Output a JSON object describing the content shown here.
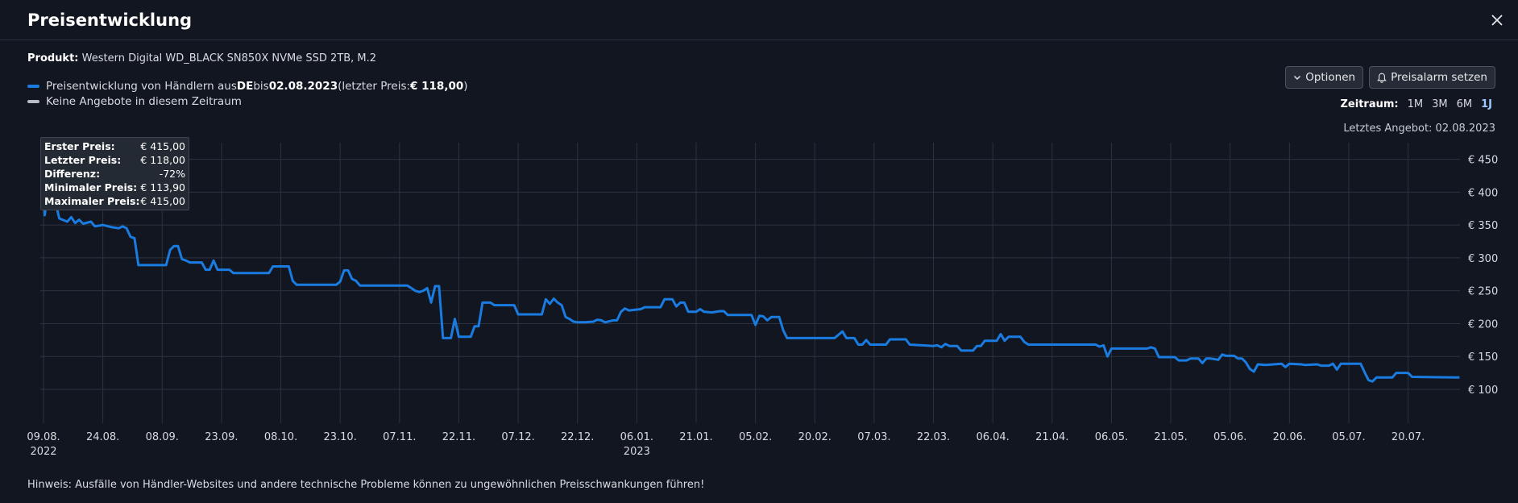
{
  "title": "Preisentwicklung",
  "product": {
    "label": "Produkt:",
    "name": "Western Digital WD_BLACK SN850X NVMe SSD 2TB, M.2"
  },
  "legend": {
    "series_prefix": "Preisentwicklung von Händlern aus ",
    "country": "DE",
    "mid": " bis ",
    "date": "02.08.2023",
    "last_price_prefix": " (letzter Preis: ",
    "last_price": "€ 118,00",
    "suffix": ")",
    "no_offers": "Keine Angebote in diesem Zeitraum",
    "series_color": "#1a7be0",
    "no_offers_color": "#b8bcc4"
  },
  "buttons": {
    "options": "Optionen",
    "alarm": "Preisalarm setzen"
  },
  "zeitraum": {
    "label": "Zeitraum:",
    "options": [
      "1M",
      "3M",
      "6M",
      "1J"
    ],
    "active": "1J"
  },
  "last_offer": "Letztes Angebot: 02.08.2023",
  "stats": [
    {
      "k": "Erster Preis:",
      "v": "€ 415,00"
    },
    {
      "k": "Letzter Preis:",
      "v": "€ 118,00"
    },
    {
      "k": "Differenz:",
      "v": "-72%"
    },
    {
      "k": "Minimaler Preis:",
      "v": "€ 113,90"
    },
    {
      "k": "Maximaler Preis:",
      "v": "€ 415,00"
    }
  ],
  "hint": "Hinweis: Ausfälle von Händler-Websites und andere technische Probleme können zu ungewöhnlichen Preisschwankungen führen!",
  "chart_data": {
    "type": "line",
    "title": "",
    "ylim": [
      50,
      460
    ],
    "y_ticks": [
      100,
      150,
      200,
      250,
      300,
      350,
      400,
      450
    ],
    "y_tick_labels": [
      "€ 100",
      "€ 150",
      "€ 200",
      "€ 250",
      "€ 300",
      "€ 350",
      "€ 400",
      "€ 450"
    ],
    "x_ticks": [
      {
        "x": 0,
        "label": "09.08.",
        "year": "2022"
      },
      {
        "x": 15,
        "label": "24.08."
      },
      {
        "x": 30,
        "label": "08.09."
      },
      {
        "x": 45,
        "label": "23.09."
      },
      {
        "x": 60,
        "label": "08.10."
      },
      {
        "x": 75,
        "label": "23.10."
      },
      {
        "x": 90,
        "label": "07.11."
      },
      {
        "x": 105,
        "label": "22.11."
      },
      {
        "x": 120,
        "label": "07.12."
      },
      {
        "x": 135,
        "label": "22.12."
      },
      {
        "x": 150,
        "label": "06.01.",
        "year": "2023"
      },
      {
        "x": 165,
        "label": "21.01."
      },
      {
        "x": 180,
        "label": "05.02."
      },
      {
        "x": 195,
        "label": "20.02."
      },
      {
        "x": 210,
        "label": "07.03."
      },
      {
        "x": 225,
        "label": "22.03."
      },
      {
        "x": 240,
        "label": "06.04."
      },
      {
        "x": 255,
        "label": "21.04."
      },
      {
        "x": 270,
        "label": "06.05."
      },
      {
        "x": 285,
        "label": "21.05."
      },
      {
        "x": 300,
        "label": "05.06."
      },
      {
        "x": 315,
        "label": "20.06."
      },
      {
        "x": 330,
        "label": "05.07."
      },
      {
        "x": 345,
        "label": "20.07."
      }
    ],
    "x_range": [
      0,
      358
    ],
    "grid": true,
    "series": [
      {
        "color": "#1a7be0",
        "points": [
          [
            0,
            415
          ],
          [
            0.3,
            365
          ],
          [
            1,
            400
          ],
          [
            3,
            385
          ],
          [
            4,
            360
          ],
          [
            6,
            355
          ],
          [
            7,
            362
          ],
          [
            8,
            353
          ],
          [
            9,
            358
          ],
          [
            10,
            352
          ],
          [
            12,
            355
          ],
          [
            13,
            348
          ],
          [
            15,
            350
          ],
          [
            17,
            347
          ],
          [
            19,
            345
          ],
          [
            20,
            348
          ],
          [
            21,
            345
          ],
          [
            22,
            332
          ],
          [
            23,
            330
          ],
          [
            24,
            289
          ],
          [
            30,
            289
          ],
          [
            31,
            289
          ],
          [
            32,
            312
          ],
          [
            33,
            318
          ],
          [
            34,
            318
          ],
          [
            35,
            298
          ],
          [
            36,
            296
          ],
          [
            37,
            293
          ],
          [
            40,
            293
          ],
          [
            41,
            282
          ],
          [
            42,
            282
          ],
          [
            43,
            296
          ],
          [
            44,
            282
          ],
          [
            47,
            282
          ],
          [
            48,
            277
          ],
          [
            55,
            277
          ],
          [
            57,
            277
          ],
          [
            58,
            287
          ],
          [
            62,
            287
          ],
          [
            63,
            265
          ],
          [
            64,
            259
          ],
          [
            74,
            259
          ],
          [
            75,
            264
          ],
          [
            76,
            281
          ],
          [
            77,
            281
          ],
          [
            78,
            268
          ],
          [
            79,
            265
          ],
          [
            80,
            258
          ],
          [
            92,
            258
          ],
          [
            93,
            254
          ],
          [
            94,
            250
          ],
          [
            95,
            248
          ],
          [
            96,
            250
          ],
          [
            97,
            254
          ],
          [
            98,
            232
          ],
          [
            99,
            257
          ],
          [
            100,
            257
          ],
          [
            101,
            178
          ],
          [
            103,
            178
          ],
          [
            104,
            207
          ],
          [
            105,
            180
          ],
          [
            108,
            180
          ],
          [
            109,
            196
          ],
          [
            110,
            196
          ],
          [
            111,
            232
          ],
          [
            113,
            232
          ],
          [
            114,
            228
          ],
          [
            119,
            228
          ],
          [
            120,
            214
          ],
          [
            126,
            214
          ],
          [
            127,
            237
          ],
          [
            128,
            230
          ],
          [
            129,
            238
          ],
          [
            130,
            232
          ],
          [
            131,
            228
          ],
          [
            132,
            210
          ],
          [
            133,
            207
          ],
          [
            134,
            203
          ],
          [
            135,
            202
          ],
          [
            137,
            202
          ],
          [
            139,
            203
          ],
          [
            140,
            206
          ],
          [
            141,
            205
          ],
          [
            142,
            202
          ],
          [
            144,
            205
          ],
          [
            145,
            205
          ],
          [
            146,
            218
          ],
          [
            147,
            223
          ],
          [
            148,
            220
          ],
          [
            151,
            222
          ],
          [
            152,
            225
          ],
          [
            156,
            225
          ],
          [
            157,
            237
          ],
          [
            159,
            237
          ],
          [
            160,
            226
          ],
          [
            161,
            232
          ],
          [
            162,
            232
          ],
          [
            163,
            218
          ],
          [
            165,
            218
          ],
          [
            166,
            222
          ],
          [
            167,
            218
          ],
          [
            169,
            217
          ],
          [
            171,
            219
          ],
          [
            172,
            219
          ],
          [
            173,
            213
          ],
          [
            179,
            213
          ],
          [
            180,
            198
          ],
          [
            181,
            212
          ],
          [
            182,
            211
          ],
          [
            183,
            205
          ],
          [
            184,
            210
          ],
          [
            186,
            210
          ],
          [
            187,
            190
          ],
          [
            188,
            178
          ],
          [
            200,
            178
          ],
          [
            202,
            188
          ],
          [
            203,
            178
          ],
          [
            205,
            178
          ],
          [
            206,
            168
          ],
          [
            207,
            168
          ],
          [
            208,
            175
          ],
          [
            209,
            168
          ],
          [
            213,
            168
          ],
          [
            214,
            176
          ],
          [
            218,
            176
          ],
          [
            219,
            168
          ],
          [
            225,
            166
          ],
          [
            226,
            167
          ],
          [
            227,
            164
          ],
          [
            228,
            169
          ],
          [
            229,
            166
          ],
          [
            231,
            166
          ],
          [
            232,
            159
          ],
          [
            235,
            159
          ],
          [
            236,
            166
          ],
          [
            237,
            166
          ],
          [
            238,
            174
          ],
          [
            241,
            174
          ],
          [
            242,
            184
          ],
          [
            243,
            174
          ],
          [
            244,
            180
          ],
          [
            247,
            180
          ],
          [
            248,
            172
          ],
          [
            249,
            168
          ],
          [
            266,
            168
          ],
          [
            267,
            165
          ],
          [
            268,
            167
          ],
          [
            269,
            150
          ],
          [
            270,
            162
          ],
          [
            272,
            162
          ],
          [
            279,
            162
          ],
          [
            280,
            164
          ],
          [
            281,
            162
          ],
          [
            282,
            149
          ],
          [
            286,
            149
          ],
          [
            287,
            144
          ],
          [
            289,
            144
          ],
          [
            290,
            147
          ],
          [
            292,
            147
          ],
          [
            293,
            140
          ],
          [
            294,
            147
          ],
          [
            295,
            147
          ],
          [
            297,
            145
          ],
          [
            298,
            153
          ],
          [
            299,
            151
          ],
          [
            301,
            151
          ],
          [
            302,
            147
          ],
          [
            303,
            147
          ],
          [
            304,
            141
          ],
          [
            305,
            131
          ],
          [
            306,
            127
          ],
          [
            307,
            138
          ],
          [
            309,
            137
          ],
          [
            313,
            139
          ],
          [
            314,
            134
          ],
          [
            315,
            139
          ],
          [
            318,
            138
          ],
          [
            319,
            137
          ],
          [
            322,
            138
          ],
          [
            323,
            136
          ],
          [
            325,
            136
          ],
          [
            326,
            139
          ],
          [
            327,
            130
          ],
          [
            328,
            139
          ],
          [
            333,
            139
          ],
          [
            334,
            126
          ],
          [
            335,
            114
          ],
          [
            336,
            112
          ],
          [
            337,
            118
          ],
          [
            338,
            118
          ],
          [
            341,
            118
          ],
          [
            342,
            125
          ],
          [
            345,
            125
          ],
          [
            346,
            119
          ],
          [
            358,
            118
          ]
        ]
      }
    ]
  }
}
